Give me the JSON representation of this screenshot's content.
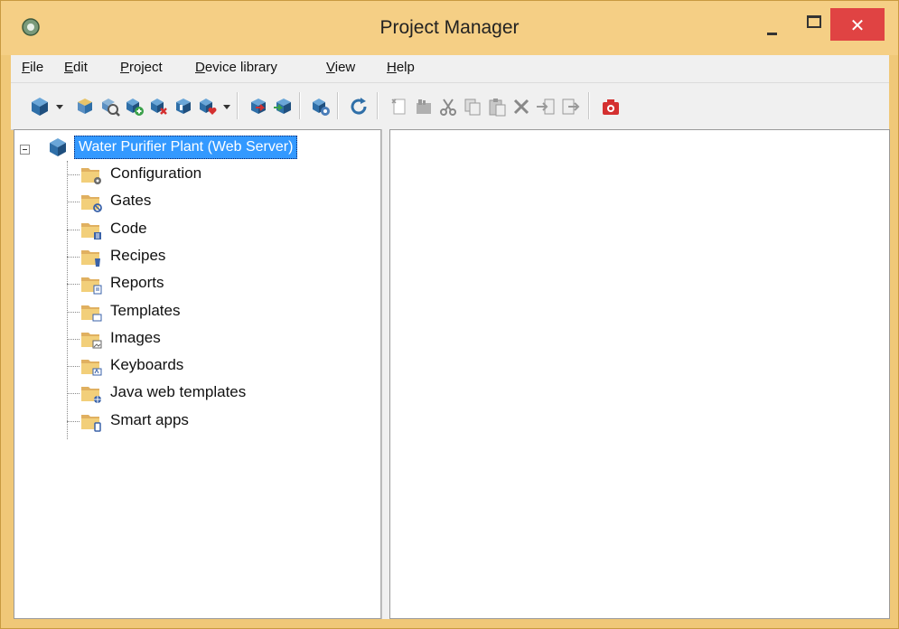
{
  "window": {
    "title": "Project Manager",
    "close_glyph": "✕",
    "colors": {
      "title_bar": "#f5cf85",
      "close_button": "#e04343",
      "selection": "#3399ff"
    }
  },
  "menu": [
    {
      "accel": "F",
      "rest": "ile"
    },
    {
      "accel": "E",
      "rest": "dit"
    },
    {
      "accel": "P",
      "rest": "roject"
    },
    {
      "accel": "D",
      "rest": "evice library"
    },
    {
      "accel": "V",
      "rest": "iew"
    },
    {
      "accel": "H",
      "rest": "elp"
    }
  ],
  "toolbar": {
    "icons": [
      "new-project-icon",
      "open-project-icon",
      "search-project-icon",
      "add-device-icon",
      "remove-device-icon",
      "device-properties-icon",
      "favorite-device-icon",
      "upload-icon",
      "download-icon",
      "compile-icon",
      "refresh-icon",
      "new-item-icon",
      "rename-icon",
      "cut-icon",
      "copy-icon",
      "paste-icon",
      "delete-icon",
      "import-icon",
      "export-icon",
      "camera-icon"
    ]
  },
  "tree": {
    "root_label": "Water Purifier Plant (Web Server)",
    "items": [
      {
        "label": "Configuration",
        "icon": "gear-icon"
      },
      {
        "label": "Gates",
        "icon": "gates-icon"
      },
      {
        "label": "Code",
        "icon": "code-icon"
      },
      {
        "label": "Recipes",
        "icon": "recipe-icon"
      },
      {
        "label": "Reports",
        "icon": "report-icon"
      },
      {
        "label": "Templates",
        "icon": "template-icon"
      },
      {
        "label": "Images",
        "icon": "image-icon"
      },
      {
        "label": "Keyboards",
        "icon": "keyboard-icon"
      },
      {
        "label": "Java web templates",
        "icon": "globe-icon"
      },
      {
        "label": "Smart apps",
        "icon": "phone-icon"
      }
    ]
  }
}
